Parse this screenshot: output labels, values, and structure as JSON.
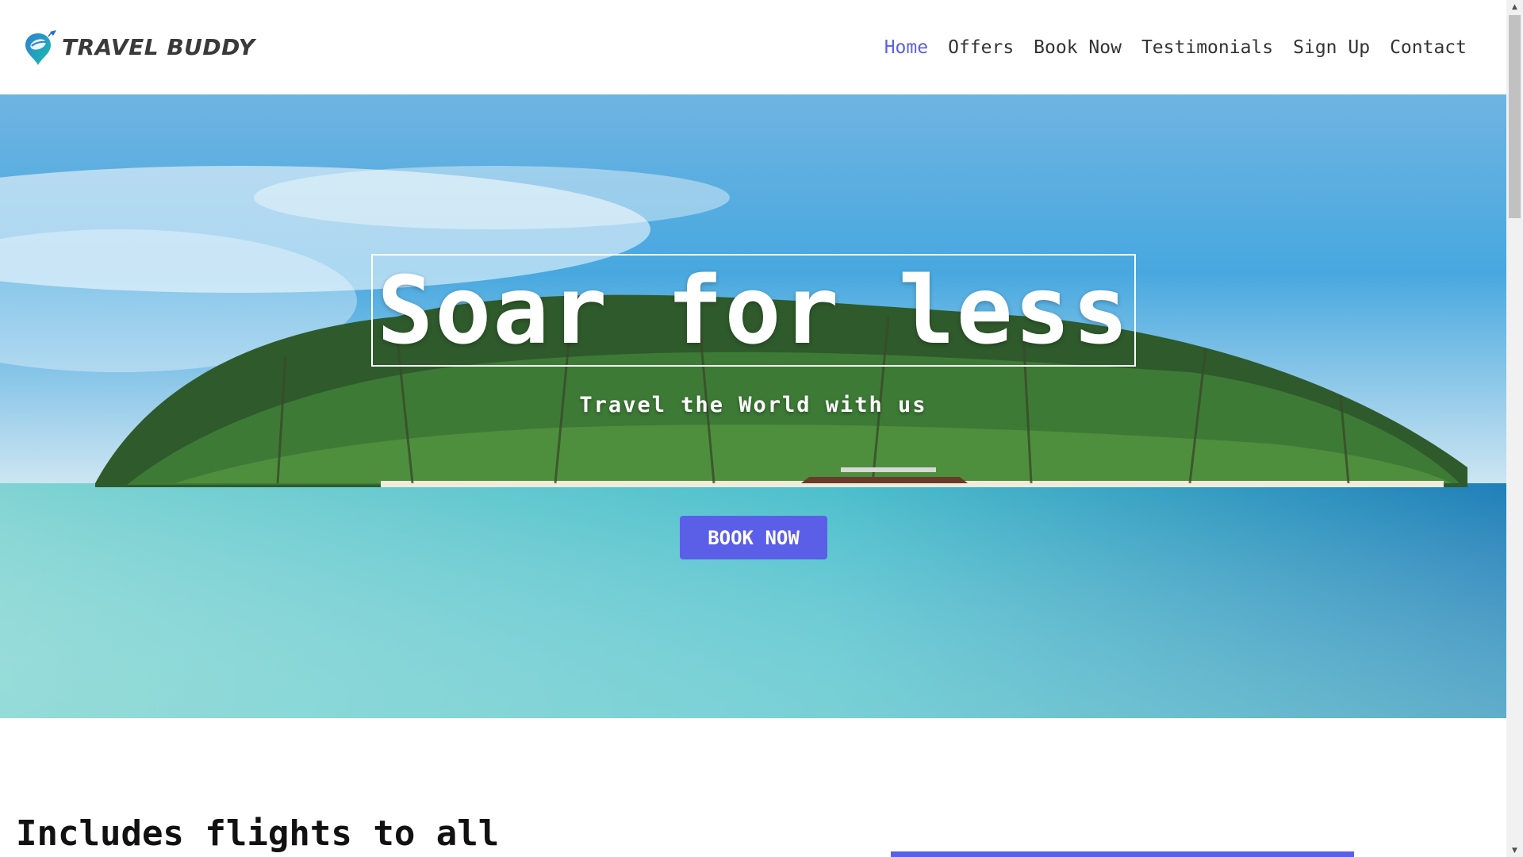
{
  "brand": {
    "name": "TRAVEL BUDDY",
    "logo_icon": "location-pin-plane-icon"
  },
  "nav": {
    "items": [
      {
        "label": "Home",
        "active": true
      },
      {
        "label": "Offers",
        "active": false
      },
      {
        "label": "Book Now",
        "active": false
      },
      {
        "label": "Testimonials",
        "active": false
      },
      {
        "label": "Sign Up",
        "active": false
      },
      {
        "label": "Contact",
        "active": false
      }
    ]
  },
  "hero": {
    "title": "Soar for less",
    "subtitle": "Travel the World with us",
    "cta_label": "BOOK NOW",
    "background": "tropical-island-palm-trees-photo"
  },
  "section": {
    "title": "Includes flights to all"
  },
  "colors": {
    "accent": "#5b5fe8",
    "nav_text": "#333333",
    "heading": "#111111"
  },
  "scrollbar": {
    "up_icon": "▲",
    "down_icon": "▼"
  }
}
